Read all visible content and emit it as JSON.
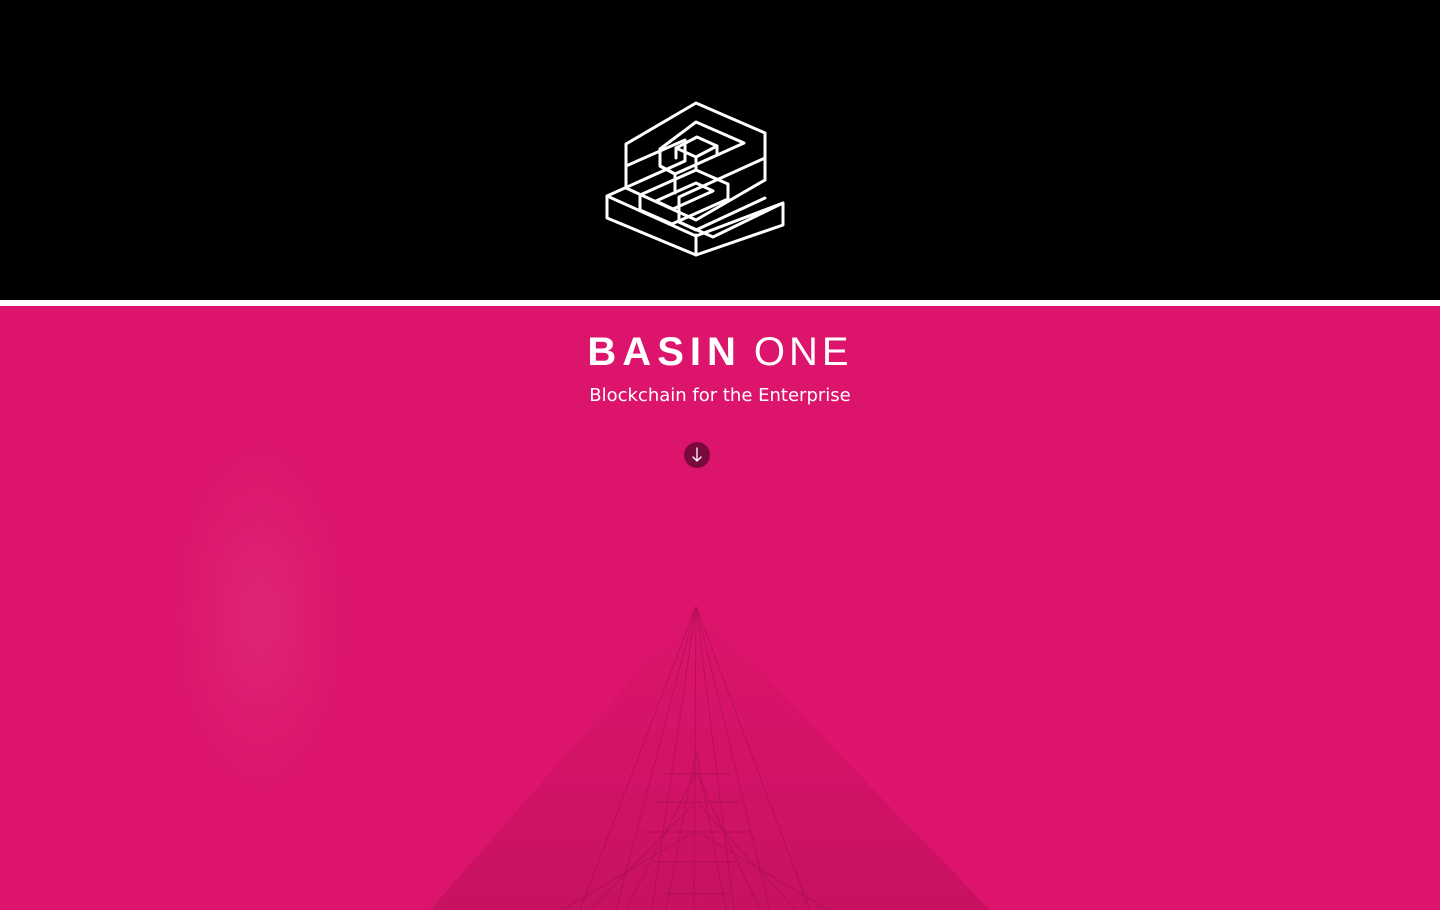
{
  "header": {
    "logo_icon": "basin-one-s-logo-icon",
    "background_color": "#000000"
  },
  "hero": {
    "title_strong": "BASIN",
    "title_light": "ONE",
    "tagline": "Blockchain for the Enterprise",
    "scroll_icon": "arrow-down-icon",
    "background_color": "#dc146b",
    "button_color": "#7a093d",
    "text_color": "#ffffff"
  }
}
